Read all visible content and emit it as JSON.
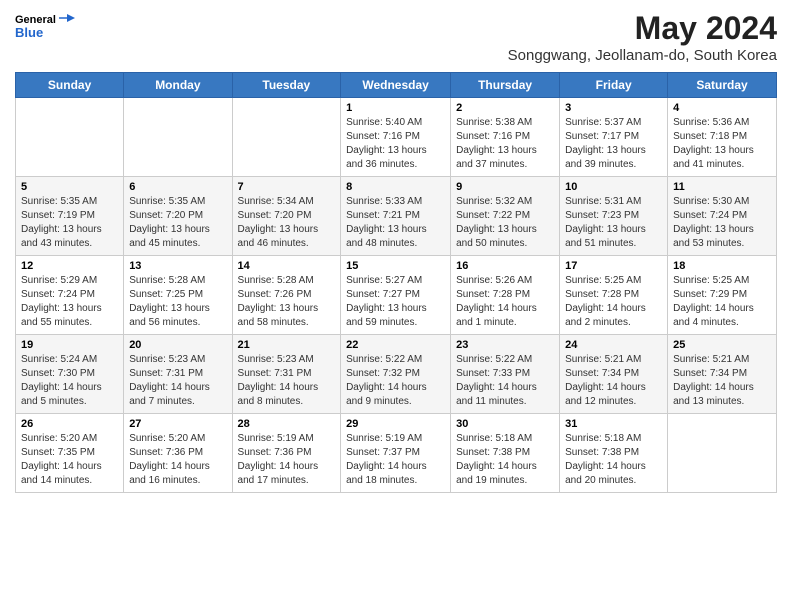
{
  "header": {
    "logo_line1": "General",
    "logo_line2": "Blue",
    "month_year": "May 2024",
    "location": "Songgwang, Jeollanam-do, South Korea"
  },
  "days_of_week": [
    "Sunday",
    "Monday",
    "Tuesday",
    "Wednesday",
    "Thursday",
    "Friday",
    "Saturday"
  ],
  "weeks": [
    [
      {
        "day": "",
        "info": ""
      },
      {
        "day": "",
        "info": ""
      },
      {
        "day": "",
        "info": ""
      },
      {
        "day": "1",
        "info": "Sunrise: 5:40 AM\nSunset: 7:16 PM\nDaylight: 13 hours and 36 minutes."
      },
      {
        "day": "2",
        "info": "Sunrise: 5:38 AM\nSunset: 7:16 PM\nDaylight: 13 hours and 37 minutes."
      },
      {
        "day": "3",
        "info": "Sunrise: 5:37 AM\nSunset: 7:17 PM\nDaylight: 13 hours and 39 minutes."
      },
      {
        "day": "4",
        "info": "Sunrise: 5:36 AM\nSunset: 7:18 PM\nDaylight: 13 hours and 41 minutes."
      }
    ],
    [
      {
        "day": "5",
        "info": "Sunrise: 5:35 AM\nSunset: 7:19 PM\nDaylight: 13 hours and 43 minutes."
      },
      {
        "day": "6",
        "info": "Sunrise: 5:35 AM\nSunset: 7:20 PM\nDaylight: 13 hours and 45 minutes."
      },
      {
        "day": "7",
        "info": "Sunrise: 5:34 AM\nSunset: 7:20 PM\nDaylight: 13 hours and 46 minutes."
      },
      {
        "day": "8",
        "info": "Sunrise: 5:33 AM\nSunset: 7:21 PM\nDaylight: 13 hours and 48 minutes."
      },
      {
        "day": "9",
        "info": "Sunrise: 5:32 AM\nSunset: 7:22 PM\nDaylight: 13 hours and 50 minutes."
      },
      {
        "day": "10",
        "info": "Sunrise: 5:31 AM\nSunset: 7:23 PM\nDaylight: 13 hours and 51 minutes."
      },
      {
        "day": "11",
        "info": "Sunrise: 5:30 AM\nSunset: 7:24 PM\nDaylight: 13 hours and 53 minutes."
      }
    ],
    [
      {
        "day": "12",
        "info": "Sunrise: 5:29 AM\nSunset: 7:24 PM\nDaylight: 13 hours and 55 minutes."
      },
      {
        "day": "13",
        "info": "Sunrise: 5:28 AM\nSunset: 7:25 PM\nDaylight: 13 hours and 56 minutes."
      },
      {
        "day": "14",
        "info": "Sunrise: 5:28 AM\nSunset: 7:26 PM\nDaylight: 13 hours and 58 minutes."
      },
      {
        "day": "15",
        "info": "Sunrise: 5:27 AM\nSunset: 7:27 PM\nDaylight: 13 hours and 59 minutes."
      },
      {
        "day": "16",
        "info": "Sunrise: 5:26 AM\nSunset: 7:28 PM\nDaylight: 14 hours and 1 minute."
      },
      {
        "day": "17",
        "info": "Sunrise: 5:25 AM\nSunset: 7:28 PM\nDaylight: 14 hours and 2 minutes."
      },
      {
        "day": "18",
        "info": "Sunrise: 5:25 AM\nSunset: 7:29 PM\nDaylight: 14 hours and 4 minutes."
      }
    ],
    [
      {
        "day": "19",
        "info": "Sunrise: 5:24 AM\nSunset: 7:30 PM\nDaylight: 14 hours and 5 minutes."
      },
      {
        "day": "20",
        "info": "Sunrise: 5:23 AM\nSunset: 7:31 PM\nDaylight: 14 hours and 7 minutes."
      },
      {
        "day": "21",
        "info": "Sunrise: 5:23 AM\nSunset: 7:31 PM\nDaylight: 14 hours and 8 minutes."
      },
      {
        "day": "22",
        "info": "Sunrise: 5:22 AM\nSunset: 7:32 PM\nDaylight: 14 hours and 9 minutes."
      },
      {
        "day": "23",
        "info": "Sunrise: 5:22 AM\nSunset: 7:33 PM\nDaylight: 14 hours and 11 minutes."
      },
      {
        "day": "24",
        "info": "Sunrise: 5:21 AM\nSunset: 7:34 PM\nDaylight: 14 hours and 12 minutes."
      },
      {
        "day": "25",
        "info": "Sunrise: 5:21 AM\nSunset: 7:34 PM\nDaylight: 14 hours and 13 minutes."
      }
    ],
    [
      {
        "day": "26",
        "info": "Sunrise: 5:20 AM\nSunset: 7:35 PM\nDaylight: 14 hours and 14 minutes."
      },
      {
        "day": "27",
        "info": "Sunrise: 5:20 AM\nSunset: 7:36 PM\nDaylight: 14 hours and 16 minutes."
      },
      {
        "day": "28",
        "info": "Sunrise: 5:19 AM\nSunset: 7:36 PM\nDaylight: 14 hours and 17 minutes."
      },
      {
        "day": "29",
        "info": "Sunrise: 5:19 AM\nSunset: 7:37 PM\nDaylight: 14 hours and 18 minutes."
      },
      {
        "day": "30",
        "info": "Sunrise: 5:18 AM\nSunset: 7:38 PM\nDaylight: 14 hours and 19 minutes."
      },
      {
        "day": "31",
        "info": "Sunrise: 5:18 AM\nSunset: 7:38 PM\nDaylight: 14 hours and 20 minutes."
      },
      {
        "day": "",
        "info": ""
      }
    ]
  ]
}
